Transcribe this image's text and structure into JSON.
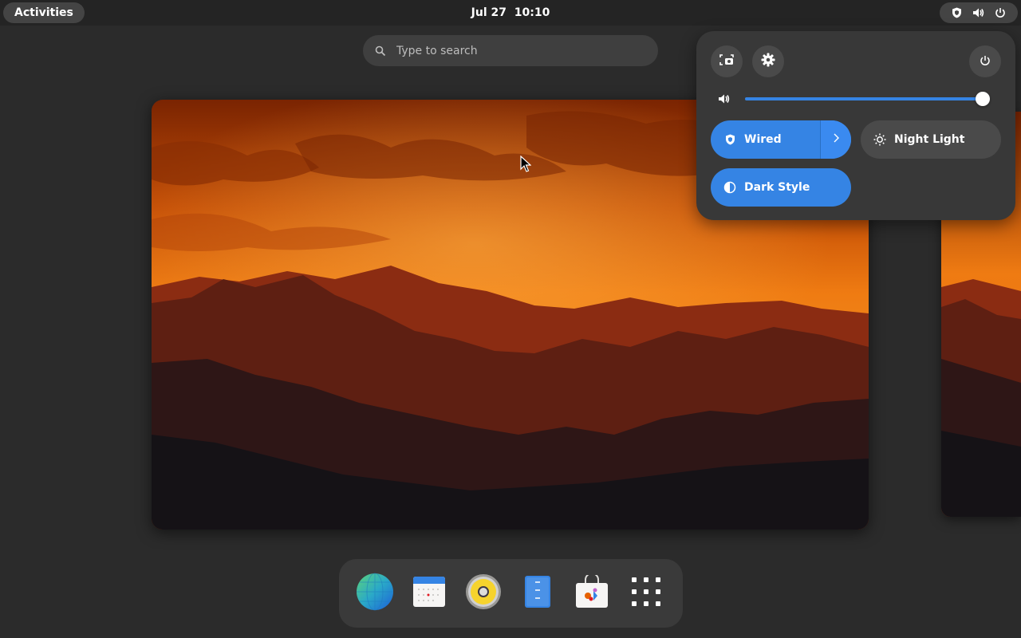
{
  "topbar": {
    "activities_label": "Activities",
    "clock": "Jul 27  10:10",
    "status_icons": [
      "vpn-shield-icon",
      "volume-icon",
      "power-icon"
    ]
  },
  "search": {
    "placeholder": "Type to search",
    "icon": "search-icon"
  },
  "quick_settings": {
    "buttons": [
      "screenshot-icon",
      "settings-gear-icon",
      "power-icon"
    ],
    "volume": {
      "icon": "volume-icon",
      "level": 1.0
    },
    "toggles": {
      "wired": {
        "label": "Wired",
        "active": true,
        "icon": "vpn-shield-icon"
      },
      "night_light": {
        "label": "Night Light",
        "active": false,
        "icon": "sun-icon"
      },
      "dark_style": {
        "label": "Dark Style",
        "active": true,
        "icon": "half-circle-icon"
      }
    },
    "accent_color": "#3584e4"
  },
  "dash": {
    "apps": [
      "web-browser-icon",
      "calendar-icon",
      "rhythmbox-speaker-icon",
      "text-editor-icon",
      "software-store-icon",
      "app-grid-icon"
    ]
  },
  "wallpaper": {
    "sky_top": "#8a2e02",
    "sky_glow": "#f47f12",
    "mountain_dark": "#1a1418"
  }
}
